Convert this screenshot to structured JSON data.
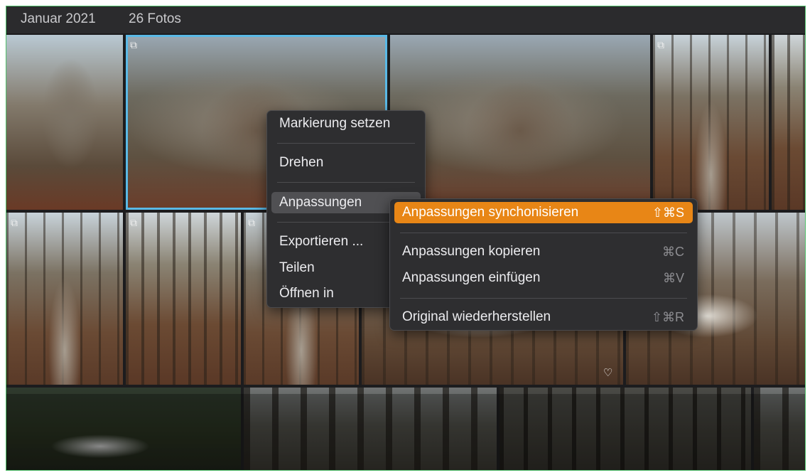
{
  "header": {
    "month": "Januar 2021",
    "count": "26 Fotos"
  },
  "context_menu": {
    "items": [
      {
        "label": "Markierung setzen"
      },
      {
        "label": "Drehen"
      },
      {
        "label": "Anpassungen"
      },
      {
        "label": "Exportieren ..."
      },
      {
        "label": "Teilen"
      },
      {
        "label": "Öffnen in"
      }
    ]
  },
  "submenu": {
    "items": [
      {
        "label": "Anpassungen synchonisieren",
        "shortcut": "⇧⌘S"
      },
      {
        "label": "Anpassungen kopieren",
        "shortcut": "⌘C"
      },
      {
        "label": "Anpassungen einfügen",
        "shortcut": "⌘V"
      },
      {
        "label": "Original wiederherstellen",
        "shortcut": "⇧⌘R"
      }
    ]
  },
  "colors": {
    "selection": "#5ab9e6",
    "menu_active": "#e88616",
    "frame_border": "#4fbf6a"
  }
}
